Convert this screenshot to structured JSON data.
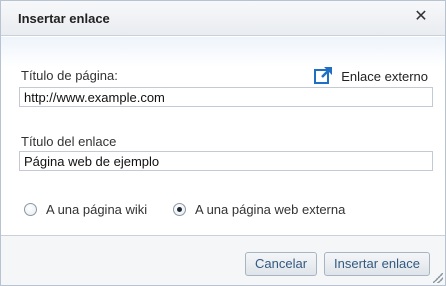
{
  "dialog": {
    "title": "Insertar enlace",
    "close_icon": "close-icon"
  },
  "form": {
    "page_title_label": "Título de página:",
    "page_title_value": "http://www.example.com",
    "external_link_label": "Enlace externo",
    "external_link_icon": "external-link-icon",
    "link_title_label": "Título del enlace",
    "link_title_value": "Página web de ejemplo",
    "options": [
      {
        "label": "A una página wiki",
        "checked": false
      },
      {
        "label": "A una página web externa",
        "checked": true
      }
    ]
  },
  "buttons": {
    "cancel": "Cancelar",
    "insert": "Insertar enlace"
  },
  "colors": {
    "icon_blue": "#1f6fc5",
    "button_text": "#33597f"
  }
}
